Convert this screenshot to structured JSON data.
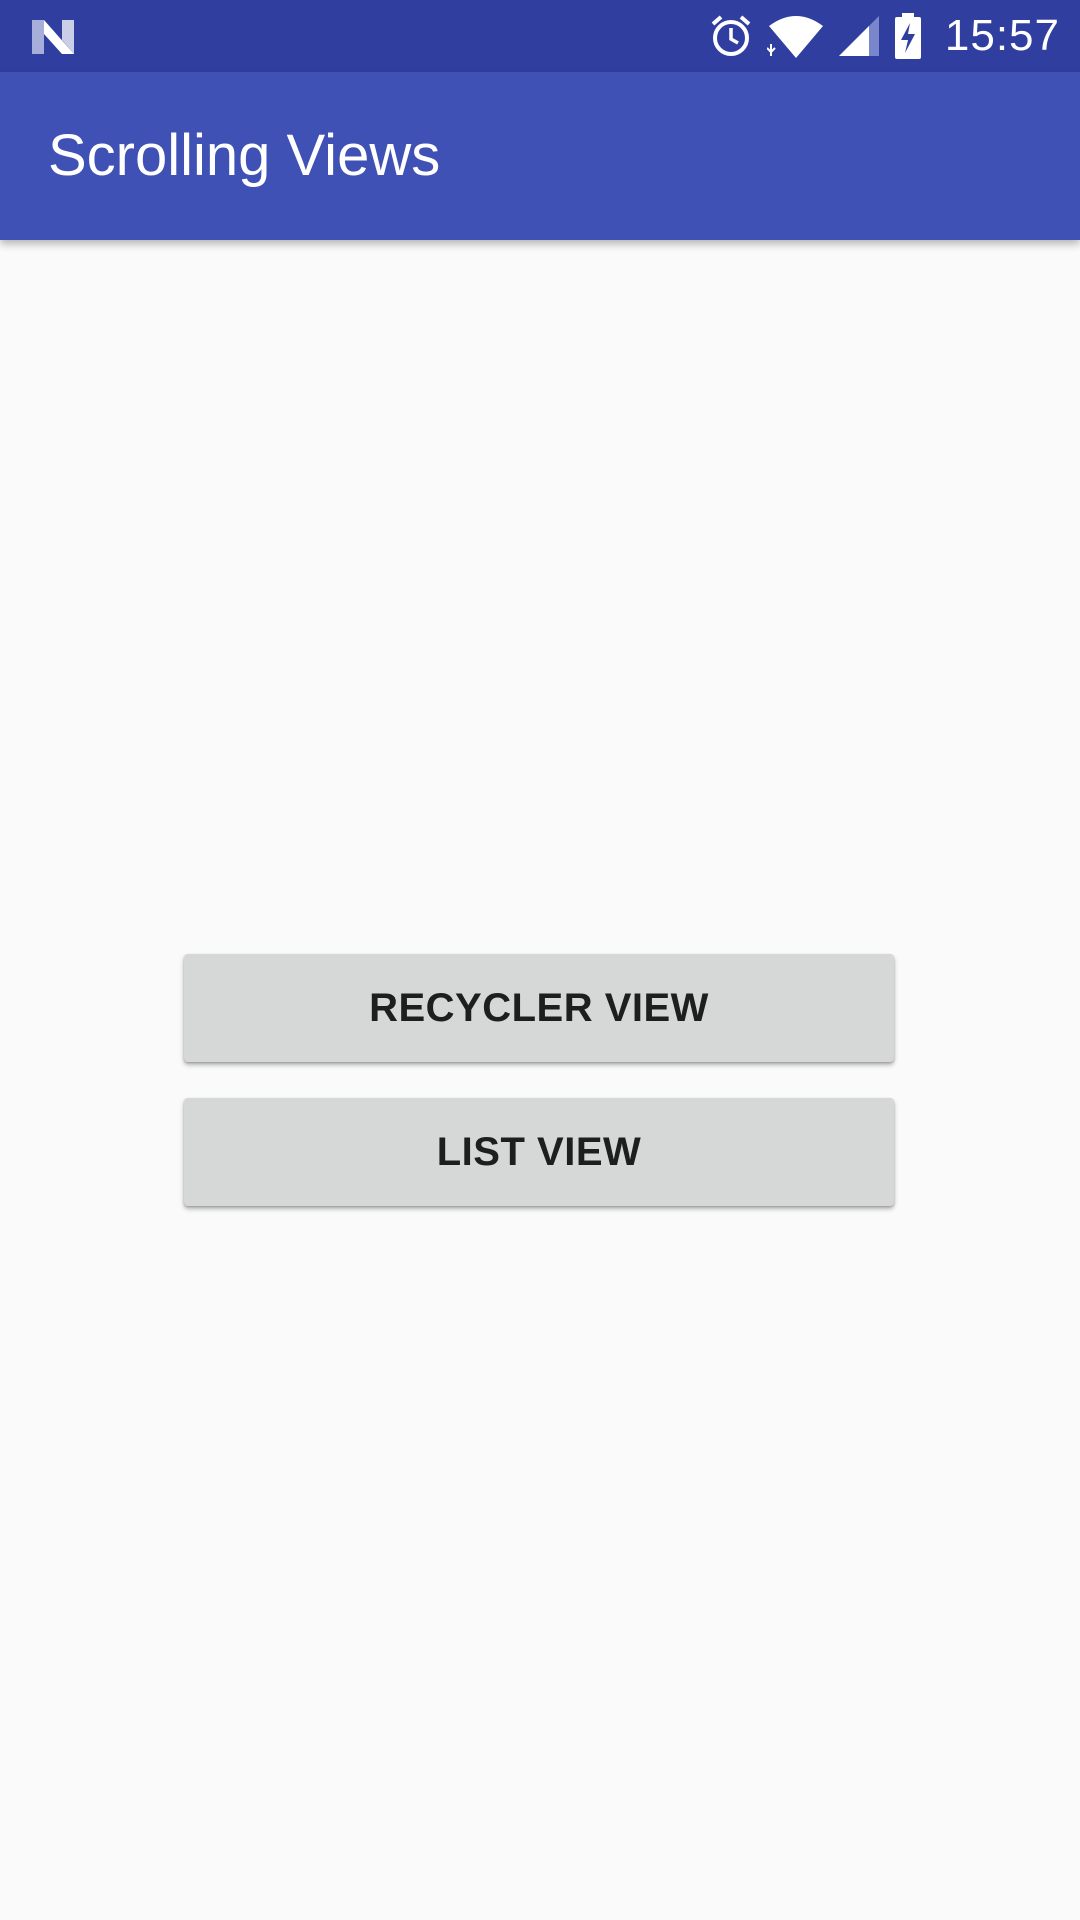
{
  "status_bar": {
    "time": "15:57",
    "icons": [
      "notification-n-icon",
      "alarm-icon",
      "wifi-icon",
      "cell-signal-icon",
      "battery-charging-icon"
    ],
    "color": "#303f9f"
  },
  "app_bar": {
    "title": "Scrolling Views",
    "color": "#3f51b5"
  },
  "main": {
    "buttons": [
      {
        "label": "RECYCLER VIEW"
      },
      {
        "label": "LIST VIEW"
      }
    ],
    "background": "#fafafa",
    "button_color": "#d6d7d7"
  }
}
